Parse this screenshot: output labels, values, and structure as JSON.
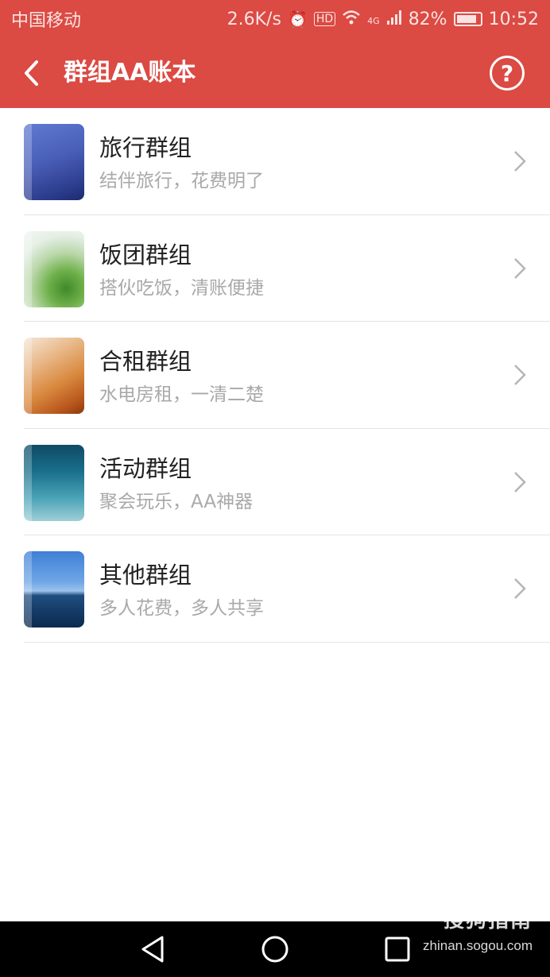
{
  "status_bar": {
    "carrier": "中国移动",
    "speed": "2.6K/s",
    "network": "4G",
    "battery": "82%",
    "time": "10:52"
  },
  "header": {
    "title": "群组AA账本",
    "help_icon": "question-circle-icon",
    "back_icon": "chevron-left-icon"
  },
  "groups": [
    {
      "title": "旅行群组",
      "subtitle": "结伴旅行，花费明了",
      "thumb": "blue-sky"
    },
    {
      "title": "饭团群组",
      "subtitle": "搭伙吃饭，清账便捷",
      "thumb": "green-leaves"
    },
    {
      "title": "合租群组",
      "subtitle": "水电房租，一清二楚",
      "thumb": "orange-waves"
    },
    {
      "title": "活动群组",
      "subtitle": "聚会玩乐，AA神器",
      "thumb": "teal-sky"
    },
    {
      "title": "其他群组",
      "subtitle": "多人花费，多人共享",
      "thumb": "ocean"
    }
  ],
  "watermark": {
    "brand": "搜狗指南",
    "url": "zhinan.sogou.com"
  },
  "colors": {
    "accent": "#db4a43",
    "title_text": "#222222",
    "subtitle_text": "#a9a9a9"
  }
}
